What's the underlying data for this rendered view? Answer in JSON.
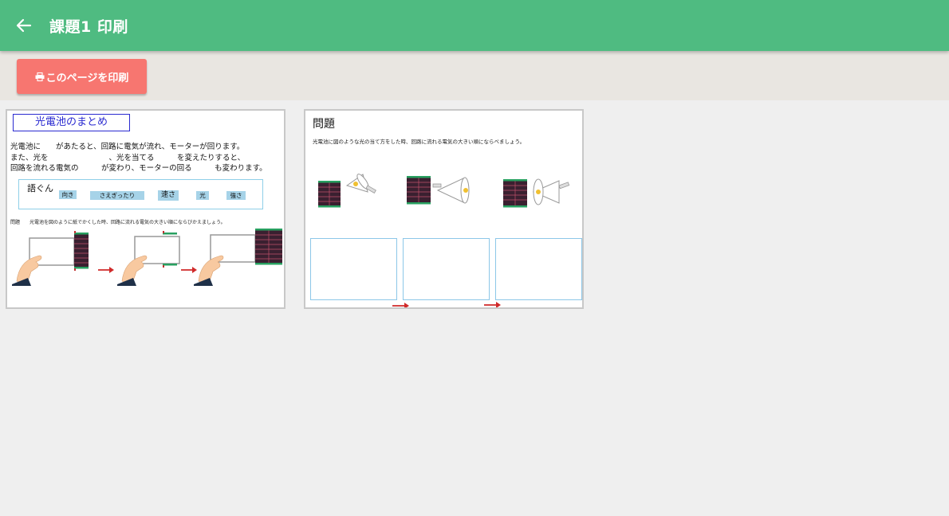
{
  "appbar": {
    "title": "課題1 印刷"
  },
  "toolbar": {
    "print_label": "このページを印刷"
  },
  "summary_page": {
    "title": "光電池のまとめ",
    "lines": [
      "光電池に　　があたると、回路に電気が流れ、モーターが回ります。",
      "また、光を　　　　　　　　、光を当てる　　　を変えたりすると、",
      "回路を流れる電気の　　　が変わり、モーターの回る　　　も変わります。"
    ],
    "vocab_label": "語ぐん",
    "vocab_words": [
      "向き",
      "さえぎったり",
      "速さ",
      "光",
      "強さ"
    ],
    "question": "問題　　光電池を図のように紙でかくした時、回路に流れる電気の大きい順にならびかえましょう。"
  },
  "problem_page": {
    "title": "問題",
    "text": "光電池に図のような光の当て方をした時、回路に流れる電気の大きい順にならべましょう。"
  },
  "colors": {
    "appbar": "#4fbb81",
    "print_button": "#f77670",
    "arrow": "#d02a2a",
    "box_border": "#8cc7e8"
  }
}
